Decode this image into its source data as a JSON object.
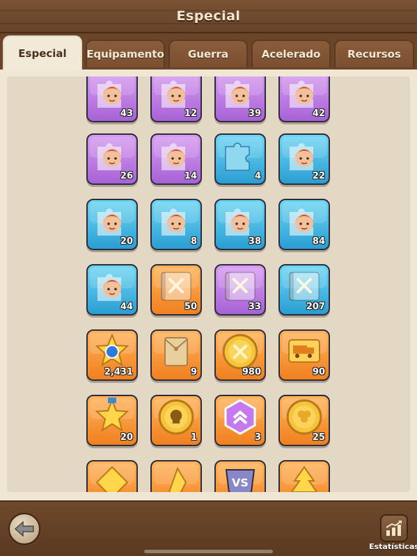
{
  "header": {
    "title": "Especial"
  },
  "tabs": [
    {
      "label": "Especial",
      "active": true
    },
    {
      "label": "Equipamento",
      "active": false
    },
    {
      "label": "Guerra",
      "active": false
    },
    {
      "label": "Acelerado",
      "active": false
    },
    {
      "label": "Recursos",
      "active": false
    }
  ],
  "items": [
    {
      "icon": "hero-puzzle-icon",
      "color": "purple",
      "count": "43"
    },
    {
      "icon": "hero-puzzle-icon",
      "color": "purple",
      "count": "12"
    },
    {
      "icon": "hero-puzzle-icon",
      "color": "purple",
      "count": "39"
    },
    {
      "icon": "hero-puzzle-icon",
      "color": "purple",
      "count": "42"
    },
    {
      "icon": "hero-puzzle-icon",
      "color": "purple",
      "count": "26"
    },
    {
      "icon": "hero-puzzle-icon",
      "color": "purple",
      "count": "14"
    },
    {
      "icon": "puzzle-piece-icon",
      "color": "blue",
      "count": "4"
    },
    {
      "icon": "hero-puzzle-icon",
      "color": "blue",
      "count": "22"
    },
    {
      "icon": "hero-puzzle-icon",
      "color": "blue",
      "count": "20"
    },
    {
      "icon": "hero-puzzle-icon",
      "color": "blue",
      "count": "8"
    },
    {
      "icon": "hero-puzzle-icon",
      "color": "blue",
      "count": "38"
    },
    {
      "icon": "hero-puzzle-icon",
      "color": "blue",
      "count": "84"
    },
    {
      "icon": "hero-puzzle-icon",
      "color": "blue",
      "count": "44"
    },
    {
      "icon": "skill-book-icon",
      "color": "orange",
      "count": "50"
    },
    {
      "icon": "skill-book-icon",
      "color": "purple",
      "count": "33"
    },
    {
      "icon": "skill-book-icon",
      "color": "blue",
      "count": "207"
    },
    {
      "icon": "star-medal-icon",
      "color": "orange",
      "count": "2,431"
    },
    {
      "icon": "envelope-icon",
      "color": "orange",
      "count": "9"
    },
    {
      "icon": "crossed-swords-coin-icon",
      "color": "orange",
      "count": "980"
    },
    {
      "icon": "truck-ticket-icon",
      "color": "orange",
      "count": "90"
    },
    {
      "icon": "star-medal-ribbon-icon",
      "color": "orange",
      "count": "20"
    },
    {
      "icon": "skull-coin-icon",
      "color": "orange",
      "count": "1"
    },
    {
      "icon": "rank-badge-icon",
      "color": "orange",
      "count": "3"
    },
    {
      "icon": "clover-coin-icon",
      "color": "orange",
      "count": "25"
    },
    {
      "icon": "gold-badge-icon",
      "color": "orange",
      "count": ""
    },
    {
      "icon": "gold-crystal-icon",
      "color": "orange",
      "count": ""
    },
    {
      "icon": "vs-badge-icon",
      "color": "orange",
      "count": ""
    },
    {
      "icon": "tree-token-icon",
      "color": "orange",
      "count": ""
    }
  ],
  "bottom": {
    "back_icon": "back-arrow-icon",
    "stats_icon": "statistics-chart-icon",
    "stats_label": "Estatísticas"
  },
  "colors": {
    "purple": "#b877e0",
    "blue": "#3fb3e0",
    "orange": "#f5922f",
    "wood": "#6b4529",
    "panel": "#e3d8c4"
  }
}
